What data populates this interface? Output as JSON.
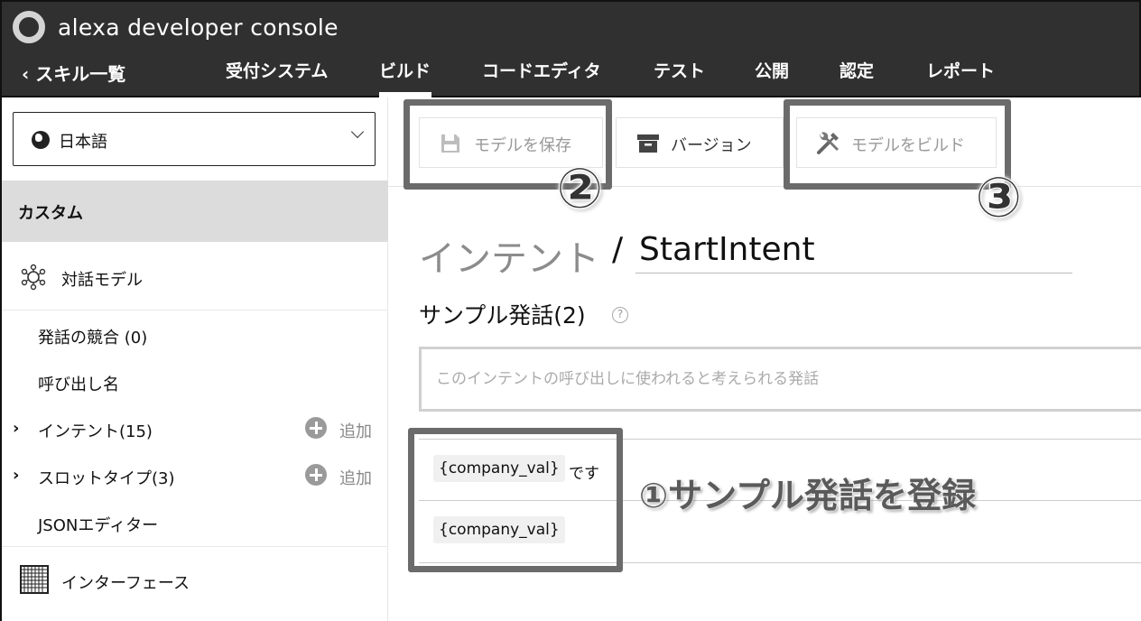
{
  "header": {
    "app_title": "alexa developer console",
    "back_link": "スキル一覧",
    "nav": [
      {
        "label": "受付システム"
      },
      {
        "label": "ビルド"
      },
      {
        "label": "コードエディタ"
      },
      {
        "label": "テスト"
      },
      {
        "label": "公開"
      },
      {
        "label": "認定"
      },
      {
        "label": "レポート"
      }
    ],
    "active_tab": "ビルド"
  },
  "sidebar": {
    "language": "日本語",
    "section_title": "カスタム",
    "items": [
      {
        "label": "対話モデル",
        "icon": "network-gear-icon"
      },
      {
        "label": "発話の競合 (0)"
      },
      {
        "label": "呼び出し名"
      },
      {
        "label": "インテント(15)",
        "add": "追加"
      },
      {
        "label": "スロットタイプ(3)",
        "add": "追加"
      },
      {
        "label": "JSONエディター"
      },
      {
        "label": "インターフェース",
        "icon": "grid-icon"
      }
    ]
  },
  "toolbar": {
    "save_model": "モデルを保存",
    "version": "バージョン",
    "build_model": "モデルをビルド"
  },
  "main": {
    "crumb": "インテント",
    "slash": "/",
    "intent_name": "StartIntent",
    "samples_heading": "サンプル発話(2)",
    "help": "?",
    "utterance_placeholder": "このインテントの呼び出しに使われると考えられる発話",
    "samples": [
      {
        "slot": "{company_val}",
        "suffix": "です"
      },
      {
        "slot": "{company_val}",
        "suffix": ""
      }
    ]
  },
  "annotations": {
    "step1": "①サンプル発話を登録",
    "step2": "②",
    "step3": "③"
  },
  "colors": {
    "header_bg": "#303030",
    "section_bg": "#dcdcdc",
    "highlight": "#6b6b6b"
  }
}
